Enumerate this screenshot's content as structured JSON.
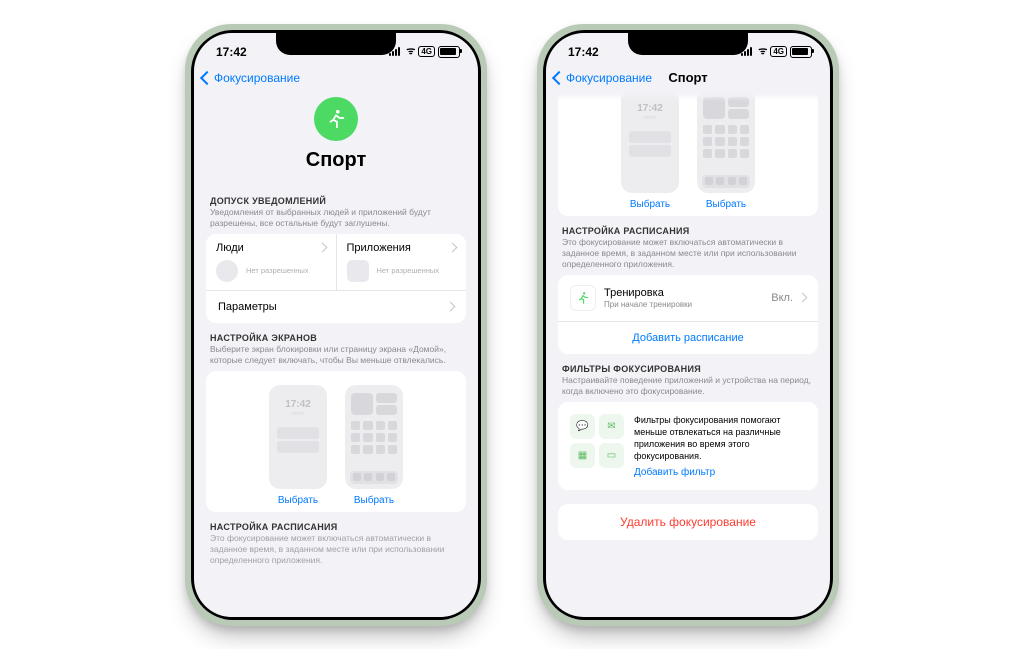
{
  "status": {
    "time": "17:42"
  },
  "nav": {
    "back": "Фокусирование",
    "title": "Спорт"
  },
  "hero": {
    "title": "Спорт"
  },
  "notif": {
    "header": "ДОПУСК УВЕДОМЛЕНИЙ",
    "desc": "Уведомления от выбранных людей и приложений будут разрешены, все остальные будут заглушены.",
    "people": "Люди",
    "apps": "Приложения",
    "none": "Нет разрешенных",
    "options": "Параметры"
  },
  "screens": {
    "header": "НАСТРОЙКА ЭКРАНОВ",
    "desc": "Выберите экран блокировки или страницу экрана «Домой», которые следует включать, чтобы Вы меньше отвлекались.",
    "choose": "Выбрать",
    "lock_time": "17:42"
  },
  "schedule": {
    "header": "НАСТРОЙКА РАСПИСАНИЯ",
    "desc": "Это фокусирование может включаться автоматически в заданное время, в заданном месте или при использовании определенного приложения.",
    "row_title": "Тренировка",
    "row_sub": "При начале тренировки",
    "row_state": "Вкл.",
    "add": "Добавить расписание"
  },
  "filters": {
    "header": "ФИЛЬТРЫ ФОКУСИРОВАНИЯ",
    "desc": "Настраивайте поведение приложений и устройства на период, когда включено это фокусирование.",
    "blurb": "Фильтры фокусирования помогают меньше отвлекаться на различные приложения во время этого фокусирования.",
    "add": "Добавить фильтр"
  },
  "delete": "Удалить фокусирование"
}
